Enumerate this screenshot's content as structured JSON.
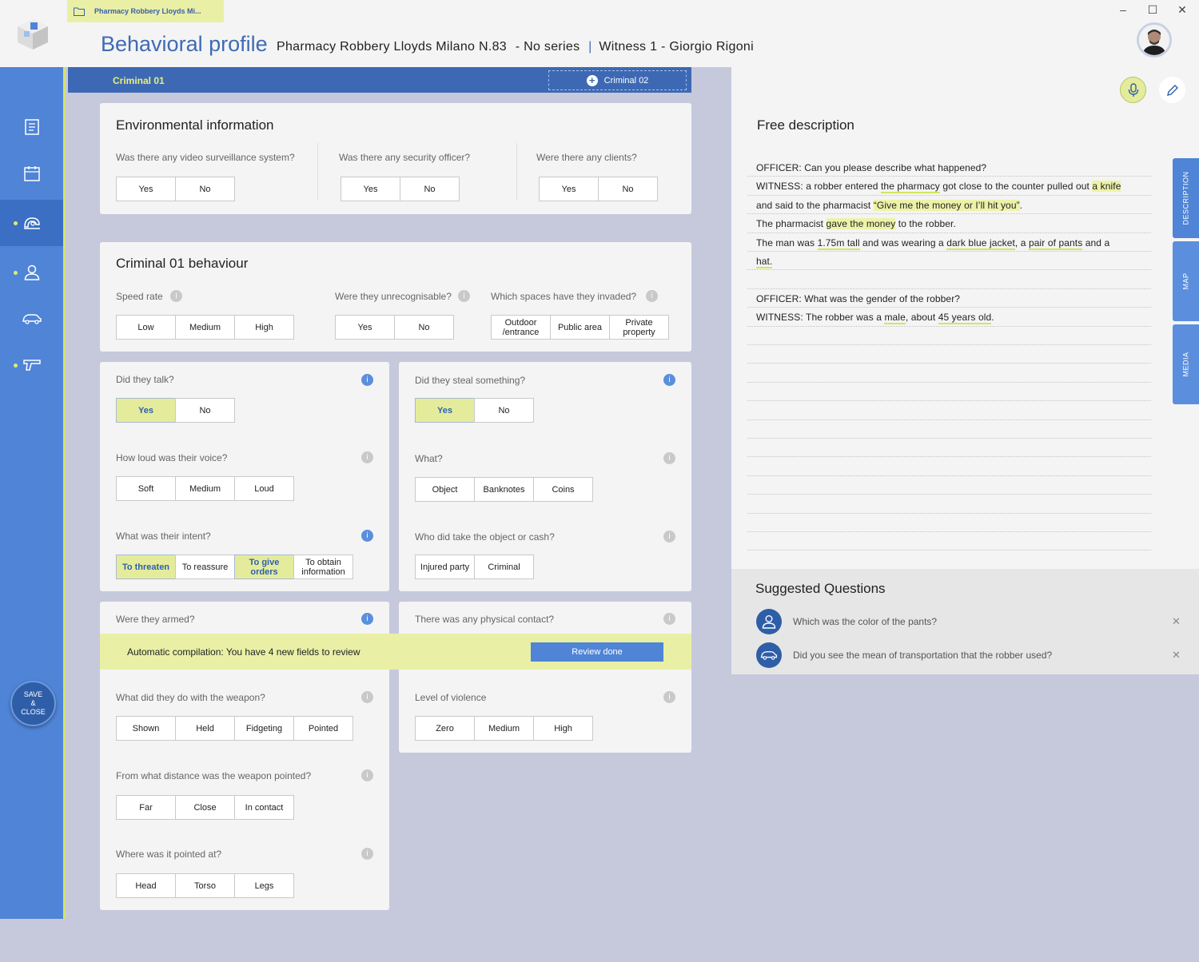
{
  "window": {
    "file_tab": "Pharmacy Robbery Lloyds Mi...",
    "title": "Behavioral profile",
    "case": "Pharmacy Robbery Lloyds Milano N.83",
    "series": "- No series",
    "witness": "Witness 1 - Giorgio Rigoni",
    "controls": [
      "–",
      "☐",
      "✕"
    ]
  },
  "sidebar": {
    "items": [
      {
        "name": "report-icon",
        "active": false,
        "dot": false
      },
      {
        "name": "calendar-icon",
        "active": false,
        "dot": false
      },
      {
        "name": "behaviour-icon",
        "active": true,
        "dot": true
      },
      {
        "name": "person-icon",
        "active": false,
        "dot": true
      },
      {
        "name": "car-icon",
        "active": false,
        "dot": false
      },
      {
        "name": "gun-icon",
        "active": false,
        "dot": true
      }
    ],
    "save_label_1": "SAVE",
    "save_label_2": "&",
    "save_label_3": "CLOSE"
  },
  "criminal_tabs": {
    "tab1": "Criminal 01",
    "tab2": "Criminal 02"
  },
  "env": {
    "title": "Environmental information",
    "q1": {
      "label": "Was there any video surveillance system?",
      "options": [
        "Yes",
        "No"
      ]
    },
    "q2": {
      "label": "Was there any security officer?",
      "options": [
        "Yes",
        "No"
      ]
    },
    "q3": {
      "label": "Were there any clients?",
      "options": [
        "Yes",
        "No"
      ]
    }
  },
  "behaviour": {
    "title": "Criminal 01 behaviour",
    "speed": {
      "label": "Speed rate",
      "options": [
        "Low",
        "Medium",
        "High"
      ]
    },
    "unrec": {
      "label": "Were they unrecognisable?",
      "options": [
        "Yes",
        "No"
      ]
    },
    "spaces": {
      "label": "Which spaces have they invaded?",
      "options": [
        "Outdoor /entrance",
        "Public area",
        "Private property"
      ]
    }
  },
  "talk": {
    "q": {
      "label": "Did they talk?",
      "options": [
        "Yes",
        "No"
      ],
      "selected": "Yes"
    },
    "voice": {
      "label": "How loud was their voice?",
      "options": [
        "Soft",
        "Medium",
        "Loud"
      ]
    },
    "intent": {
      "label": "What was their intent?",
      "options": [
        "To threaten",
        "To reassure",
        "To give orders",
        "To obtain information"
      ],
      "selected": [
        "To threaten",
        "To give orders"
      ]
    }
  },
  "steal": {
    "q": {
      "label": "Did they steal something?",
      "options": [
        "Yes",
        "No"
      ],
      "selected": "Yes"
    },
    "what": {
      "label": "What?",
      "options": [
        "Object",
        "Banknotes",
        "Coins"
      ]
    },
    "who": {
      "label": "Who did take the object or cash?",
      "options": [
        "Injured party",
        "Criminal"
      ]
    }
  },
  "armed": {
    "label": "Were they armed?",
    "weapon": {
      "label": "What did they do with the weapon?",
      "options": [
        "Shown",
        "Held",
        "Fidgeting",
        "Pointed"
      ]
    },
    "distance": {
      "label": "From what distance was the weapon pointed?",
      "options": [
        "Far",
        "Close",
        "In contact"
      ]
    },
    "where": {
      "label": "Where was it pointed at?",
      "options": [
        "Head",
        "Torso",
        "Legs"
      ]
    }
  },
  "contact": {
    "label": "There was any physical contact?",
    "violence": {
      "label": "Level of violence",
      "options": [
        "Zero",
        "Medium",
        "High"
      ]
    }
  },
  "banner": {
    "text": "Automatic compilation: You have 4 new fields to review",
    "button": "Review done"
  },
  "description": {
    "title": "Free description",
    "tabs": [
      "DESCRIPTION",
      "MAP",
      "MEDIA"
    ],
    "line1": "OFFICER: Can you please describe what happened?",
    "line2": {
      "p1": "WITNESS: a robber entered ",
      "p2": "the pharmacy",
      "p3": " got close to the counter pulled out ",
      "p4": "a knife"
    },
    "line3": {
      "p1": "and said to the pharmacist ",
      "p2": "“Give me the money or I’ll hit you”",
      "p3": "."
    },
    "line4": {
      "p1": "The pharmacist ",
      "p2": "gave the money",
      "p3": " to the robber."
    },
    "line5": {
      "p1": "The man was ",
      "p2": "1.75m tall",
      "p3": " and was wearing a ",
      "p4": "dark blue jacket",
      "p5": ", a ",
      "p6": "pair of pants",
      "p7": " and a"
    },
    "line6": "hat.",
    "line7": "OFFICER: What was the gender of the robber?",
    "line8": {
      "p1": "WITNESS: The robber was a ",
      "p2": "male",
      "p3": ", about ",
      "p4": "45 years old",
      "p5": "."
    }
  },
  "suggested": {
    "title": "Suggested Questions",
    "items": [
      {
        "icon": "person-icon",
        "text": "Which was the color of the pants?"
      },
      {
        "icon": "car-icon",
        "text": "Did you see the mean of transportation that the robber used?"
      }
    ]
  },
  "colors": {
    "accent": "#4f84d6",
    "dark_accent": "#3d69b4",
    "highlight": "#e4ec9c",
    "sidebar_border": "#d5e36a"
  }
}
